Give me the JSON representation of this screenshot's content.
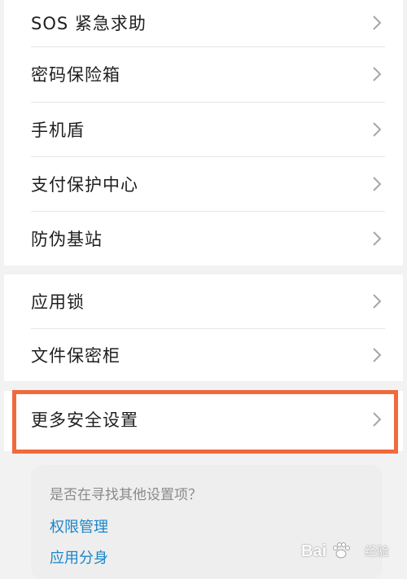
{
  "security_menu": {
    "group1": [
      {
        "label": "SOS 紧急求助"
      },
      {
        "label": "密码保险箱"
      },
      {
        "label": "手机盾"
      },
      {
        "label": "支付保护中心"
      },
      {
        "label": "防伪基站"
      }
    ],
    "group2": [
      {
        "label": "应用锁"
      },
      {
        "label": "文件保密柜"
      }
    ],
    "group3": [
      {
        "label": "更多安全设置"
      }
    ]
  },
  "suggestions": {
    "prompt": "是否在寻找其他设置项？",
    "links": [
      "权限管理",
      "应用分身"
    ]
  },
  "watermark": {
    "brand": "Bai",
    "suffix": "经验"
  },
  "colors": {
    "highlight_border": "#f06a3b",
    "link": "#1a86c9",
    "text": "#1f1f1f",
    "muted": "#8a8a8a",
    "background": "#f2f2f2"
  }
}
